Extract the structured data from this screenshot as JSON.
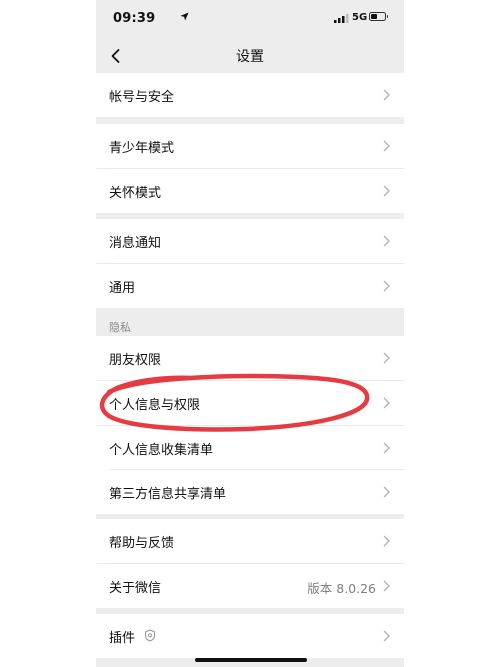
{
  "status_bar": {
    "time": "09:39",
    "network": "5G"
  },
  "nav": {
    "title": "设置"
  },
  "sections": {
    "account": {
      "items": [
        {
          "label": "帐号与安全"
        }
      ]
    },
    "modes": {
      "items": [
        {
          "label": "青少年模式"
        },
        {
          "label": "关怀模式"
        }
      ]
    },
    "general": {
      "items": [
        {
          "label": "消息通知"
        },
        {
          "label": "通用"
        }
      ]
    },
    "privacy": {
      "header": "隐私",
      "items": [
        {
          "label": "朋友权限"
        },
        {
          "label": "个人信息与权限"
        },
        {
          "label": "个人信息收集清单"
        },
        {
          "label": "第三方信息共享清单"
        }
      ]
    },
    "about": {
      "items": [
        {
          "label": "帮助与反馈"
        },
        {
          "label": "关于微信",
          "value": "版本 8.0.26"
        }
      ]
    },
    "plugins": {
      "items": [
        {
          "label": "插件"
        }
      ]
    }
  },
  "colors": {
    "background": "#ededed",
    "row": "#ffffff",
    "annotation": "#e2262c"
  }
}
